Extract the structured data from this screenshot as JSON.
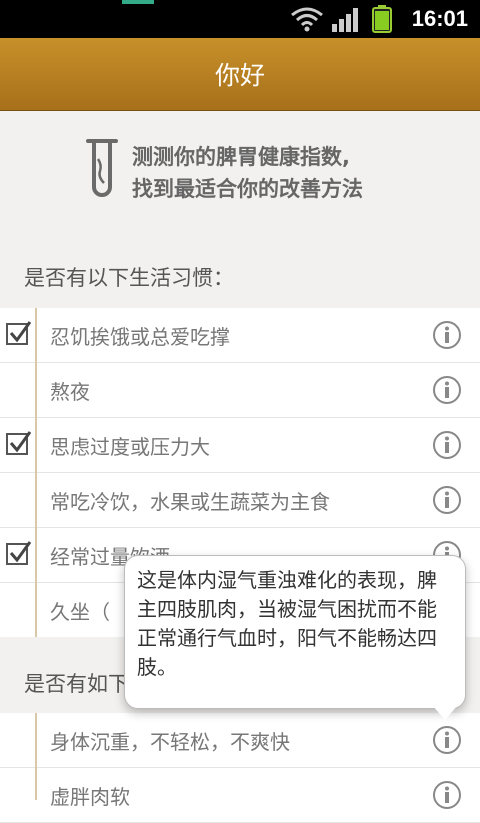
{
  "status": {
    "time": "16:01"
  },
  "header": {
    "title": "你好"
  },
  "intro": {
    "line1": "测测你的脾胃健康指数,",
    "line2": "找到最适合你的改善方法"
  },
  "section1": {
    "title": "是否有以下生活习惯：",
    "items": [
      {
        "label": "忍饥挨饿或总爱吃撑",
        "checked": true
      },
      {
        "label": "熬夜",
        "checked": false
      },
      {
        "label": "思虑过度或压力大",
        "checked": true
      },
      {
        "label": "常吃冷饮，水果或生蔬菜为主食",
        "checked": false
      },
      {
        "label": "经常过量饮酒",
        "checked": true
      },
      {
        "label": "久坐（",
        "checked": false
      }
    ]
  },
  "section2": {
    "title": "是否有如下",
    "items": [
      {
        "label": "身体沉重，不轻松，不爽快",
        "checked": false
      },
      {
        "label": "虚胖肉软",
        "checked": false
      }
    ]
  },
  "tooltip": {
    "text": "这是体内湿气重浊难化的表现，脾主四肢肌肉，当被湿气困扰而不能正常通行气血时，阳气不能畅达四肢。"
  }
}
